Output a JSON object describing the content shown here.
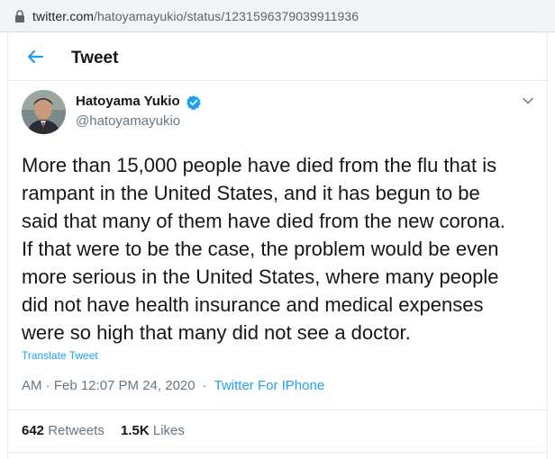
{
  "browser": {
    "url_host": "twitter.com",
    "url_path": "/hatoyamayukio/status/1231596379039911936"
  },
  "header": {
    "title": "Tweet"
  },
  "author": {
    "display_name": "Hatoyama Yukio",
    "handle": "@hatoyamayukio"
  },
  "tweet": {
    "text": "More than 15,000 people have died from the flu that is\nrampant in the United States, and it has begun to be\nsaid that many of them have died from the new corona.\nIf that were to be the case, the problem would be even\nmore serious in the United States, where many people\ndid not have health insurance and medical expenses\nwere so high that many did not see a doctor.",
    "translate_label": "Translate Tweet",
    "timestamp": "AM · Feb 12:07 PM 24, 2020",
    "separator": "·",
    "source": "Twitter For IPhone"
  },
  "stats": {
    "retweets_count": "642",
    "retweets_label": "Retweets",
    "likes_count": "1.5K",
    "likes_label": "Likes"
  },
  "colors": {
    "accent": "#1da1f2",
    "secondary_text": "#657786",
    "border": "#e6ecf0"
  },
  "icons": {
    "lock": "lock-icon",
    "back": "back-arrow-icon",
    "verified": "verified-badge-icon",
    "caret": "chevron-down-icon"
  }
}
